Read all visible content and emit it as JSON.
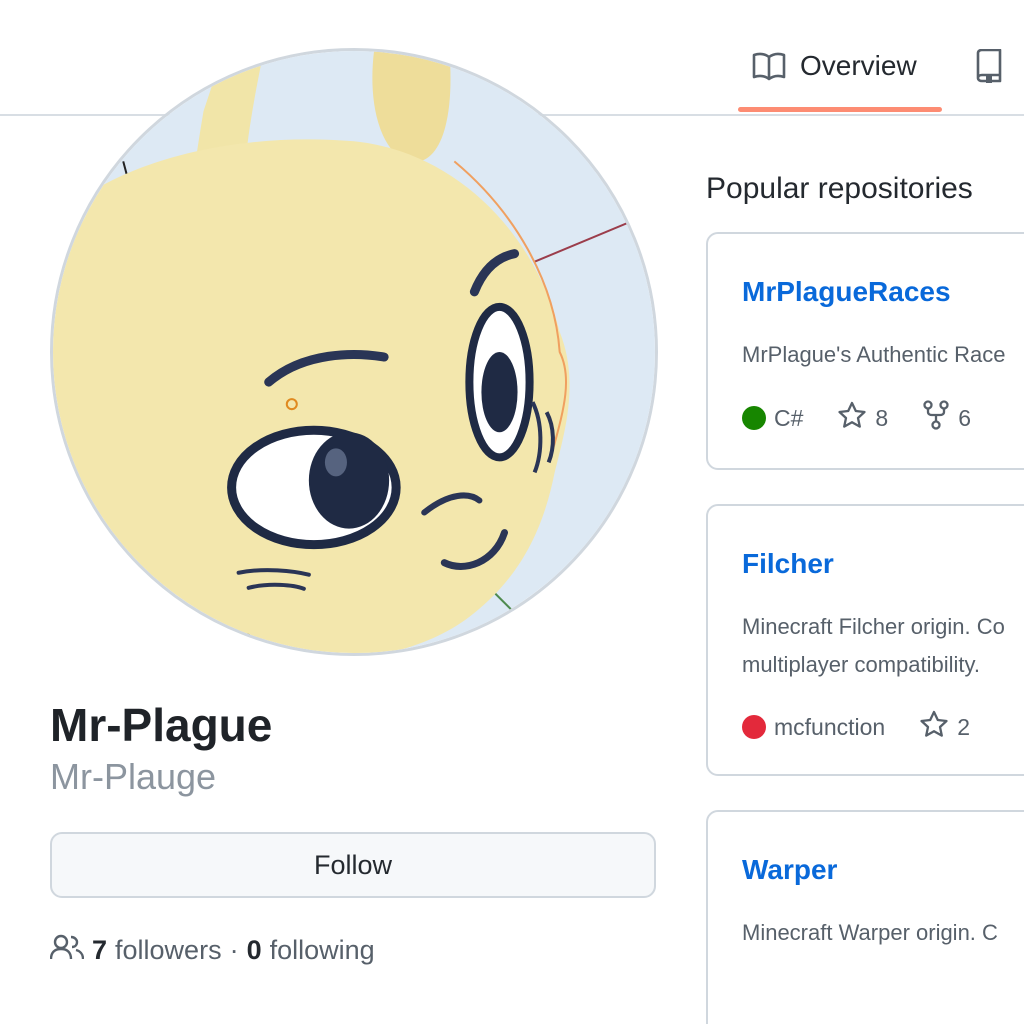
{
  "nav": {
    "tabs": [
      {
        "label": "Overview",
        "icon": "book-icon",
        "selected": true
      },
      {
        "label": "",
        "icon": "repo-icon",
        "selected": false
      }
    ]
  },
  "profile": {
    "full_name": "Mr-Plague",
    "username": "Mr-Plauge",
    "follow_label": "Follow",
    "followers_count": "7",
    "followers_label": "followers",
    "separator": "·",
    "following_count": "0",
    "following_label": "following"
  },
  "popular": {
    "title": "Popular repositories",
    "repos": [
      {
        "name": "MrPlagueRaces",
        "description": [
          "MrPlague's Authentic Race"
        ],
        "language": "C#",
        "language_color": "#178600",
        "stars": "8",
        "forks": "6"
      },
      {
        "name": "Filcher",
        "description": [
          "Minecraft Filcher origin. Co",
          "multiplayer compatibility."
        ],
        "language": "mcfunction",
        "language_color": "#e3293b",
        "stars": "2"
      },
      {
        "name": "Warper",
        "description": [
          "Minecraft Warper origin. C"
        ]
      }
    ]
  },
  "colors": {
    "accent_underline": "#fd8c73",
    "link": "#0969da",
    "muted": "#57606a"
  }
}
